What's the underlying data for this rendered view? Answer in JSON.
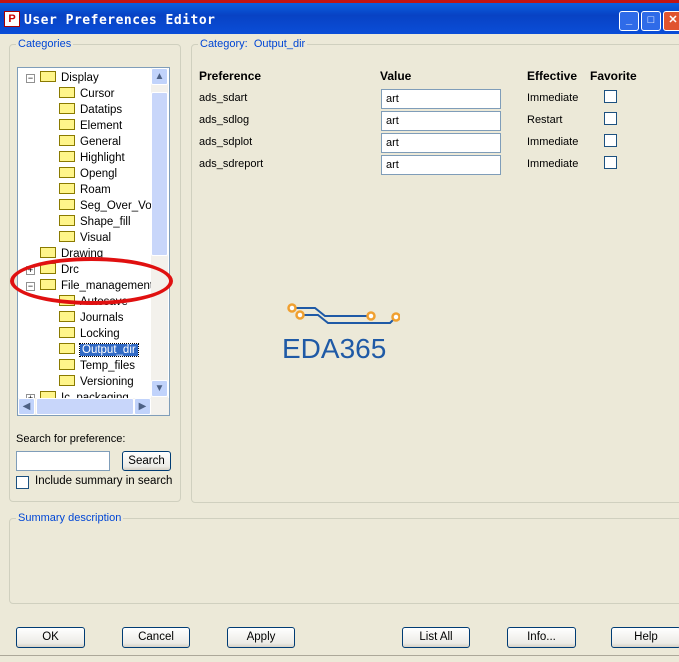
{
  "window": {
    "title": "User Preferences Editor"
  },
  "categories": {
    "label": "Categories",
    "tree": [
      {
        "label": "Display",
        "level": 1,
        "expander": "minus"
      },
      {
        "label": "Cursor",
        "level": 2
      },
      {
        "label": "Datatips",
        "level": 2
      },
      {
        "label": "Element",
        "level": 2
      },
      {
        "label": "General",
        "level": 2
      },
      {
        "label": "Highlight",
        "level": 2
      },
      {
        "label": "Opengl",
        "level": 2
      },
      {
        "label": "Roam",
        "level": 2
      },
      {
        "label": "Seg_Over_Voi",
        "level": 2
      },
      {
        "label": "Shape_fill",
        "level": 2
      },
      {
        "label": "Visual",
        "level": 2
      },
      {
        "label": "Drawing",
        "level": 1,
        "expander": "none"
      },
      {
        "label": "Drc",
        "level": 1,
        "expander": "plus"
      },
      {
        "label": "File_management",
        "level": 1,
        "expander": "minus"
      },
      {
        "label": "Autosave",
        "level": 2
      },
      {
        "label": "Journals",
        "level": 2
      },
      {
        "label": "Locking",
        "level": 2
      },
      {
        "label": "Output_dir",
        "level": 2,
        "selected": true
      },
      {
        "label": "Temp_files",
        "level": 2
      },
      {
        "label": "Versioning",
        "level": 2
      },
      {
        "label": "Ic_packaging",
        "level": 1,
        "expander": "plus"
      }
    ],
    "search_label": "Search for preference:",
    "search_value": "",
    "search_button": "Search",
    "include_summary_label": "Include summary in search",
    "include_summary_checked": false
  },
  "category_panel": {
    "label_prefix": "Category:",
    "category": "Output_dir",
    "columns": [
      "Preference",
      "Value",
      "Effective",
      "Favorite"
    ],
    "rows": [
      {
        "preference": "ads_sdart",
        "value": "art",
        "effective": "Immediate",
        "favorite": false
      },
      {
        "preference": "ads_sdlog",
        "value": "art",
        "effective": "Restart",
        "favorite": false
      },
      {
        "preference": "ads_sdplot",
        "value": "art",
        "effective": "Immediate",
        "favorite": false
      },
      {
        "preference": "ads_sdreport",
        "value": "art",
        "effective": "Immediate",
        "favorite": false
      }
    ],
    "watermark": "EDA365"
  },
  "summary": {
    "label": "Summary description",
    "text": ""
  },
  "buttons": {
    "ok": "OK",
    "cancel": "Cancel",
    "apply": "Apply",
    "list_all": "List All",
    "info": "Info...",
    "help": "Help"
  },
  "colors": {
    "accent": "#0046D5",
    "selection": "#316AC5",
    "annotation": "#E01010"
  }
}
